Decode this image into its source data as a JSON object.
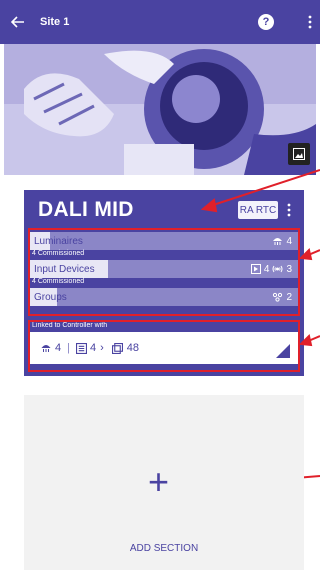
{
  "appbar": {
    "title": "Site 1",
    "help_symbol": "?"
  },
  "card": {
    "name": "DALI MID",
    "rtc_label": "RA RTC",
    "rows": [
      {
        "label": "Luminaires",
        "sub": "4 Commissioned",
        "fill_fraction": 0.07,
        "metrics": [
          {
            "icon": "luminaire-icon",
            "value": "4"
          }
        ]
      },
      {
        "label": "Input Devices",
        "sub": "4 Commissioned",
        "fill_fraction": 0.29,
        "metrics": [
          {
            "icon": "input-device-icon",
            "value": "4"
          },
          {
            "icon": "sensor-icon",
            "value": "3"
          }
        ]
      },
      {
        "label": "Groups",
        "sub": "",
        "fill_fraction": 0.1,
        "metrics": [
          {
            "icon": "group-icon",
            "value": "2"
          }
        ]
      }
    ],
    "linked": {
      "caption": "Linked to Controller with",
      "items": [
        {
          "icon": "luminaire-icon",
          "value": "4"
        },
        {
          "icon": "input-device-icon",
          "value": "4"
        },
        {
          "icon": "group-icon",
          "value": "48"
        }
      ],
      "sep": "|",
      "chevron": "›"
    }
  },
  "add_section": {
    "plus": "+",
    "label": "ADD SECTION"
  },
  "colors": {
    "primary": "#4a43a1",
    "annotation": "#e0202a"
  }
}
